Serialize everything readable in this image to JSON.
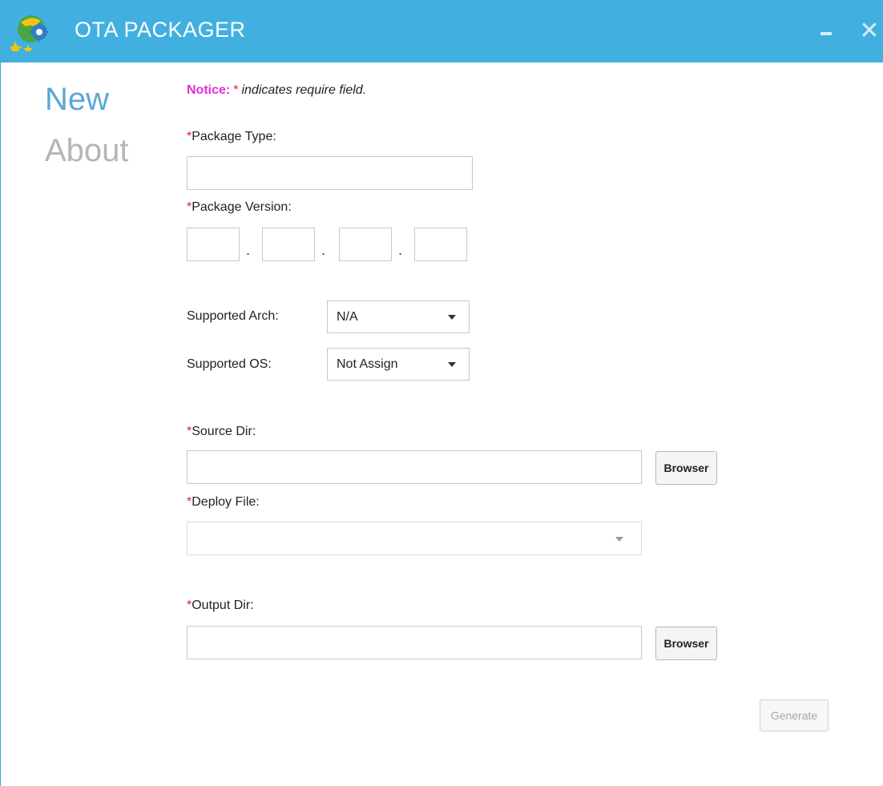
{
  "window": {
    "title": "OTA PACKAGER",
    "close_glyph": "✕",
    "icons": [
      "app-logo-icon",
      "minimize-icon",
      "close-icon"
    ]
  },
  "nav": {
    "items": [
      {
        "label": "New",
        "active": true
      },
      {
        "label": "About",
        "active": false
      }
    ]
  },
  "notice": {
    "label": "Notice:",
    "star": "*",
    "text": "indicates require field."
  },
  "form": {
    "required_mark": "*",
    "package_type": {
      "label": "Package Type:",
      "value": ""
    },
    "package_version": {
      "label": "Package Version:",
      "parts": [
        "",
        "",
        "",
        ""
      ],
      "separator": "."
    },
    "supported_arch": {
      "label": "Supported Arch:",
      "value": "N/A"
    },
    "supported_os": {
      "label": "Supported OS:",
      "value": "Not Assign"
    },
    "source_dir": {
      "label": "Source Dir:",
      "value": "",
      "button": "Browser"
    },
    "deploy_file": {
      "label": "Deploy File:",
      "value": ""
    },
    "output_dir": {
      "label": "Output Dir:",
      "value": "",
      "button": "Browser"
    },
    "generate_button": "Generate"
  },
  "colors": {
    "titlebar": "#41b0e0",
    "nav_active": "#5aa7d8",
    "nav_inactive": "#b5b5b5",
    "notice_label": "#e52ed8",
    "required": "#e02020"
  }
}
